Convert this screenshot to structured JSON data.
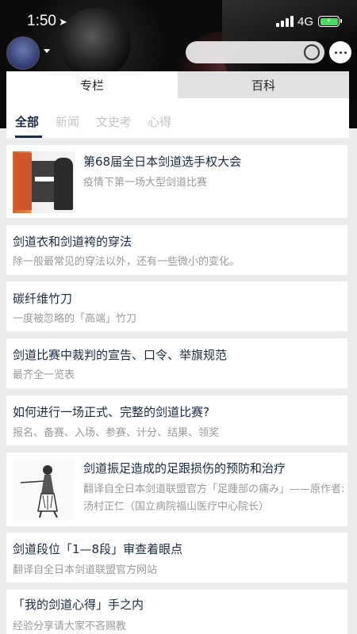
{
  "status": {
    "time": "1:50",
    "network": "4G"
  },
  "tabs": [
    {
      "label": "专栏"
    },
    {
      "label": "百科"
    }
  ],
  "subtabs": [
    {
      "label": "全部"
    },
    {
      "label": "新闻"
    },
    {
      "label": "文史考"
    },
    {
      "label": "心得"
    }
  ],
  "articles": [
    {
      "title": "第68届全日本剑道选手权大会",
      "subtitle": "疫情下第一场大型剑道比赛"
    },
    {
      "title": "剑道衣和剑道袴的穿法",
      "subtitle": "除一般最常见的穿法以外，还有一些微小的变化。"
    },
    {
      "title": "碳纤维竹刀",
      "subtitle": "一度被忽略的「高端」竹刀"
    },
    {
      "title": "剑道比赛中裁判的宣告、口令、举旗规范",
      "subtitle": "最齐全一览表"
    },
    {
      "title": "如何进行一场正式、完整的剑道比赛?",
      "subtitle": "报名、备赛、入场、参赛、计分、结果、领奖"
    },
    {
      "title": "剑道振足造成的足跟损伤的预防和治疗",
      "subtitle": "翻译自全日本剑道联盟官方「足踵部の痛み」——原作者:",
      "subtitle2": "汤村正仁（国立病院福山医疗中心院长）"
    },
    {
      "title": "剑道段位「1—8段」审查着眼点",
      "subtitle": "翻译自全日本剑道联盟官方网站"
    },
    {
      "title": "「我的剑道心得」手之内",
      "subtitle": "经验分享请大家不吝赐教"
    }
  ],
  "colors": {
    "title": "#1a2a3f",
    "subtitle": "#9a9a9a",
    "battery": "#4cd964"
  }
}
